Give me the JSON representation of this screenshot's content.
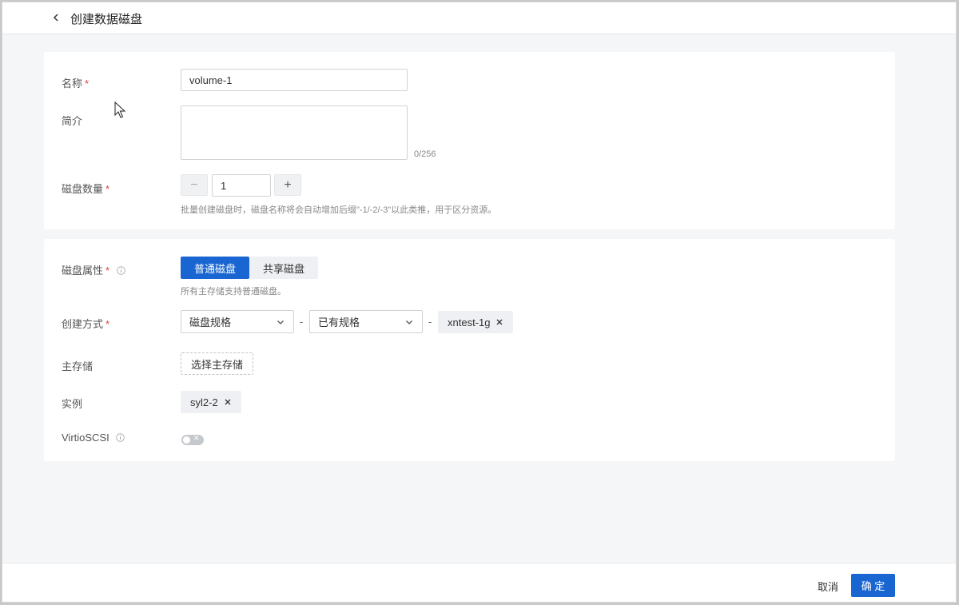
{
  "header": {
    "title": "创建数据磁盘"
  },
  "basic": {
    "name_label": "名称",
    "name_value": "volume-1",
    "desc_label": "简介",
    "desc_value": "",
    "desc_counter": "0/256",
    "count_label": "磁盘数量",
    "count_value": "1",
    "count_minus": "−",
    "count_plus": "+",
    "count_hint": "批量创建磁盘时，磁盘名称将会自动增加后缀\"-1/-2/-3\"以此类推，用于区分资源。"
  },
  "required_mark": "*",
  "attrs": {
    "disk_type_label": "磁盘属性",
    "disk_type_options": [
      "普通磁盘",
      "共享磁盘"
    ],
    "disk_type_selected": "普通磁盘",
    "disk_type_hint": "所有主存储支持普通磁盘。",
    "create_method_label": "创建方式",
    "create_method_select1": "磁盘规格",
    "create_method_select2": "已有规格",
    "create_method_sep": "-",
    "offering_tag": "xntest-1g",
    "primary_storage_label": "主存储",
    "primary_storage_button": "选择主存储",
    "instance_label": "实例",
    "instance_tag": "syl2-2",
    "virtio_label": "VirtioSCSI",
    "virtio_enabled": false,
    "virtio_off_glyph": "✕"
  },
  "footer": {
    "cancel": "取消",
    "confirm": "确 定"
  },
  "colors": {
    "primary": "#1966d2",
    "required": "#e0413a"
  }
}
